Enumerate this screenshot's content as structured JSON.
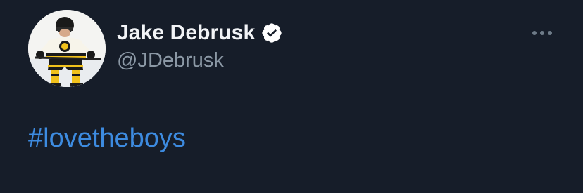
{
  "tweet": {
    "author": {
      "display_name": "Jake Debrusk",
      "handle": "@JDebrusk",
      "verified": true,
      "avatar_icon": "hockey-player-avatar",
      "verified_icon": "verified-badge-icon"
    },
    "more_icon": "more-options-icon",
    "body": {
      "hashtag": "#lovetheboys"
    }
  },
  "colors": {
    "background": "#161d29",
    "name": "#f2f4f7",
    "handle": "#8b98a5",
    "link": "#3d8be0",
    "badge": "#ffffff"
  }
}
